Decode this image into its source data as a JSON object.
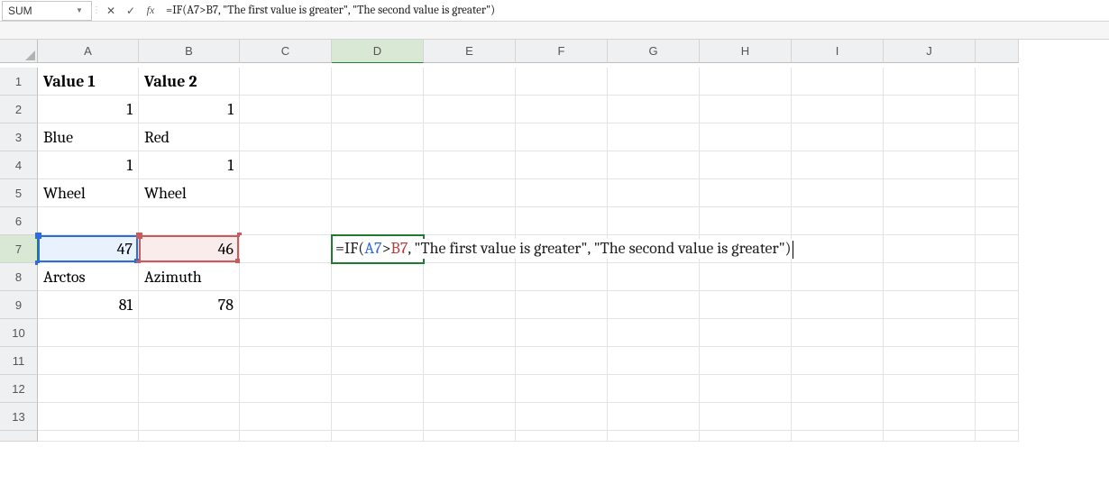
{
  "nameBox": "SUM",
  "formulaBar": "=IF(A7>B7, \"The first value is greater\", \"The second value is greater\")",
  "columns": [
    "A",
    "B",
    "C",
    "D",
    "E",
    "F",
    "G",
    "H",
    "I",
    "J"
  ],
  "activeColumn": "D",
  "activeRow": 7,
  "rows": 13,
  "cells": {
    "A1": {
      "v": "Value 1",
      "bold": true,
      "align": "left"
    },
    "B1": {
      "v": "Value 2",
      "bold": true,
      "align": "left"
    },
    "A2": {
      "v": "1",
      "align": "right"
    },
    "B2": {
      "v": "1",
      "align": "right"
    },
    "A3": {
      "v": "Blue",
      "align": "left"
    },
    "B3": {
      "v": "Red",
      "align": "left"
    },
    "A4": {
      "v": "1",
      "align": "right"
    },
    "B4": {
      "v": "1",
      "align": "right"
    },
    "A5": {
      "v": "Wheel",
      "align": "left"
    },
    "B5": {
      "v": "Wheel",
      "align": "left"
    },
    "A7": {
      "v": "47",
      "align": "right",
      "ref": "blue"
    },
    "B7": {
      "v": "46",
      "align": "right",
      "ref": "red"
    },
    "A8": {
      "v": "Arctos",
      "align": "left"
    },
    "B8": {
      "v": "Azimuth",
      "align": "left"
    },
    "A9": {
      "v": "81",
      "align": "right"
    },
    "B9": {
      "v": "78",
      "align": "right"
    }
  },
  "editCell": {
    "address": "D7",
    "tokens": [
      {
        "t": "=IF(",
        "c": "fn"
      },
      {
        "t": "A7",
        "c": "ref-a"
      },
      {
        "t": ">",
        "c": "fn"
      },
      {
        "t": "B7",
        "c": "ref-b"
      },
      {
        "t": ", \"The first value is greater\", \"The second value is greater\")",
        "c": "str"
      }
    ]
  }
}
